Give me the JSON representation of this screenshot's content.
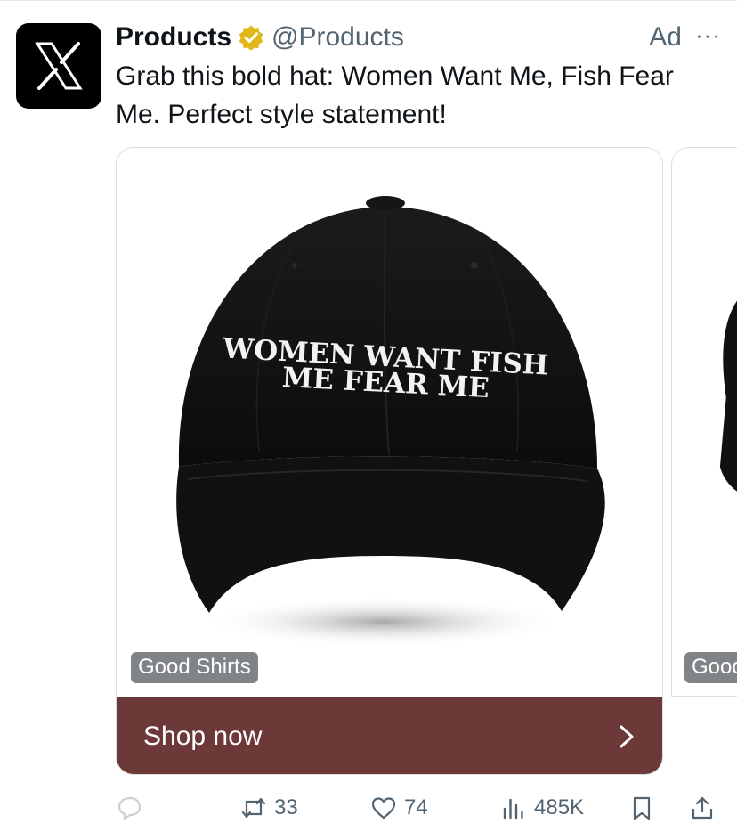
{
  "post": {
    "display_name": "Products",
    "handle": "@Products",
    "ad_label": "Ad",
    "more_label": "···",
    "text": "Grab this bold hat: Women Want Me, Fish Fear Me. Perfect style statement!"
  },
  "carousel": {
    "cards": [
      {
        "brand": "Good Shirts",
        "hat_text_line1": "WOMEN WANT FISH",
        "hat_text_line2": "ME FEAR ME",
        "cta": "Shop now"
      },
      {
        "brand": "Good Shirts"
      }
    ]
  },
  "actions": {
    "retweets": "33",
    "likes": "74",
    "views": "485K"
  },
  "colors": {
    "cta_background": "#6c3838",
    "verified_gold": "#e2b719",
    "secondary_text": "#536471"
  },
  "icons": [
    "x-logo-icon",
    "verified-badge-icon",
    "chevron-right-icon",
    "reply-icon",
    "retweet-icon",
    "like-icon",
    "views-icon",
    "bookmark-icon",
    "share-icon"
  ]
}
